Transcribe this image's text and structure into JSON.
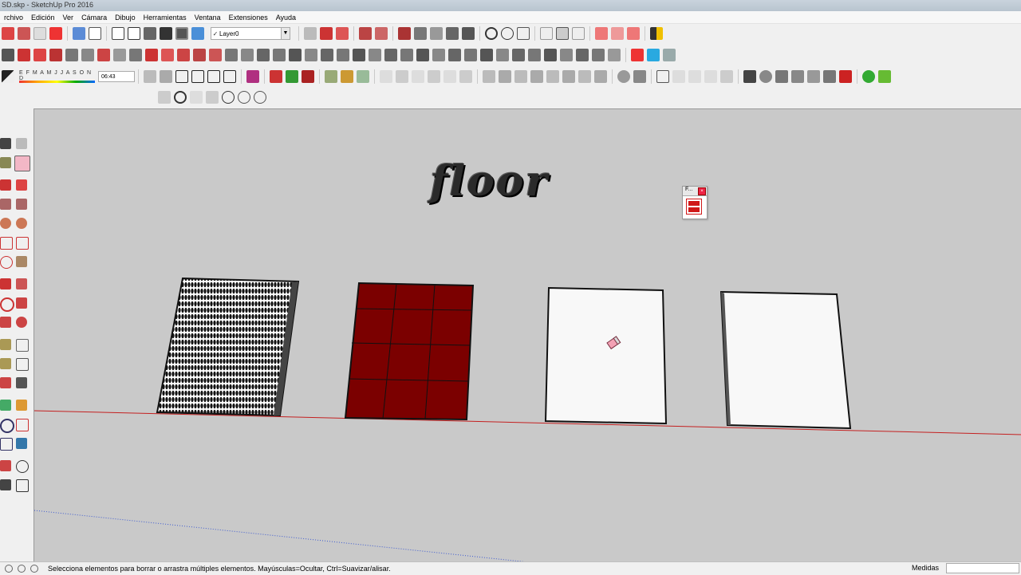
{
  "window": {
    "title": "SD.skp - SketchUp Pro 2016"
  },
  "menu": [
    "rchivo",
    "Edición",
    "Ver",
    "Cámara",
    "Dibujo",
    "Herramientas",
    "Ventana",
    "Extensiones",
    "Ayuda"
  ],
  "layers": {
    "current": "Layer0"
  },
  "shadows": {
    "months": "E F M A M J J A S O N D",
    "time": "06:43"
  },
  "scene": {
    "title_text": "floor",
    "panels": [
      {
        "name": "mesh",
        "fill": "#ffffff"
      },
      {
        "name": "brick",
        "fill": "#7b0000",
        "grid": "3x4"
      },
      {
        "name": "white-1",
        "fill": "#f8f8f8"
      },
      {
        "name": "white-2",
        "fill": "#f8f8f8"
      }
    ],
    "mini_panel": {
      "title": "F..."
    }
  },
  "status": {
    "hint": "Selecciona elementos para borrar o arrastra múltiples elementos. Mayúsculas=Ocultar, Ctrl=Suavizar/alisar.",
    "measure_label": "Medidas",
    "measure_value": ""
  },
  "colors": {
    "axis_red": "#c42020",
    "axis_blue": "#3e5bd0",
    "viewport_bg": "#c9c9c9"
  },
  "icons": {
    "toolbar_row1": [
      "new-icon",
      "open-icon",
      "save-icon",
      "print-icon",
      "iso-view-icon",
      "top-view-icon",
      "front-view-icon",
      "right-view-icon",
      "back-view-icon",
      "left-view-icon",
      "xray-icon",
      "wireframe-icon",
      "hidden-line-icon",
      "shaded-icon",
      "textured-icon",
      "monochrome-icon",
      "section-plane-icon",
      "section-display-icon",
      "warehouse-icon",
      "extension-warehouse-icon",
      "share-model-icon",
      "components-icon",
      "styles-icon",
      "fog-icon",
      "match-photo-icon",
      "geolocate-icon",
      "terrain-icon",
      "sandbox-icon",
      "solid-tools-icon",
      "dimensions-icon"
    ],
    "left_toolbar": [
      "select-icon",
      "component-icon",
      "paint-bucket-icon",
      "eraser-icon",
      "line-icon",
      "freehand-icon",
      "rectangle-icon",
      "rotated-rectangle-icon",
      "circle-icon",
      "polygon-icon",
      "arc-icon",
      "pie-icon",
      "move-icon",
      "push-pull-icon",
      "rotate-icon",
      "follow-me-icon",
      "scale-icon",
      "offset-icon",
      "tape-icon",
      "dimension-icon",
      "protractor-icon",
      "text-icon",
      "axes-icon",
      "3d-text-icon",
      "orbit-icon",
      "pan-icon",
      "zoom-icon",
      "zoom-window-icon",
      "zoom-extents-icon",
      "previous-icon",
      "position-camera-icon",
      "look-around-icon",
      "walk-icon",
      "section-icon"
    ]
  }
}
